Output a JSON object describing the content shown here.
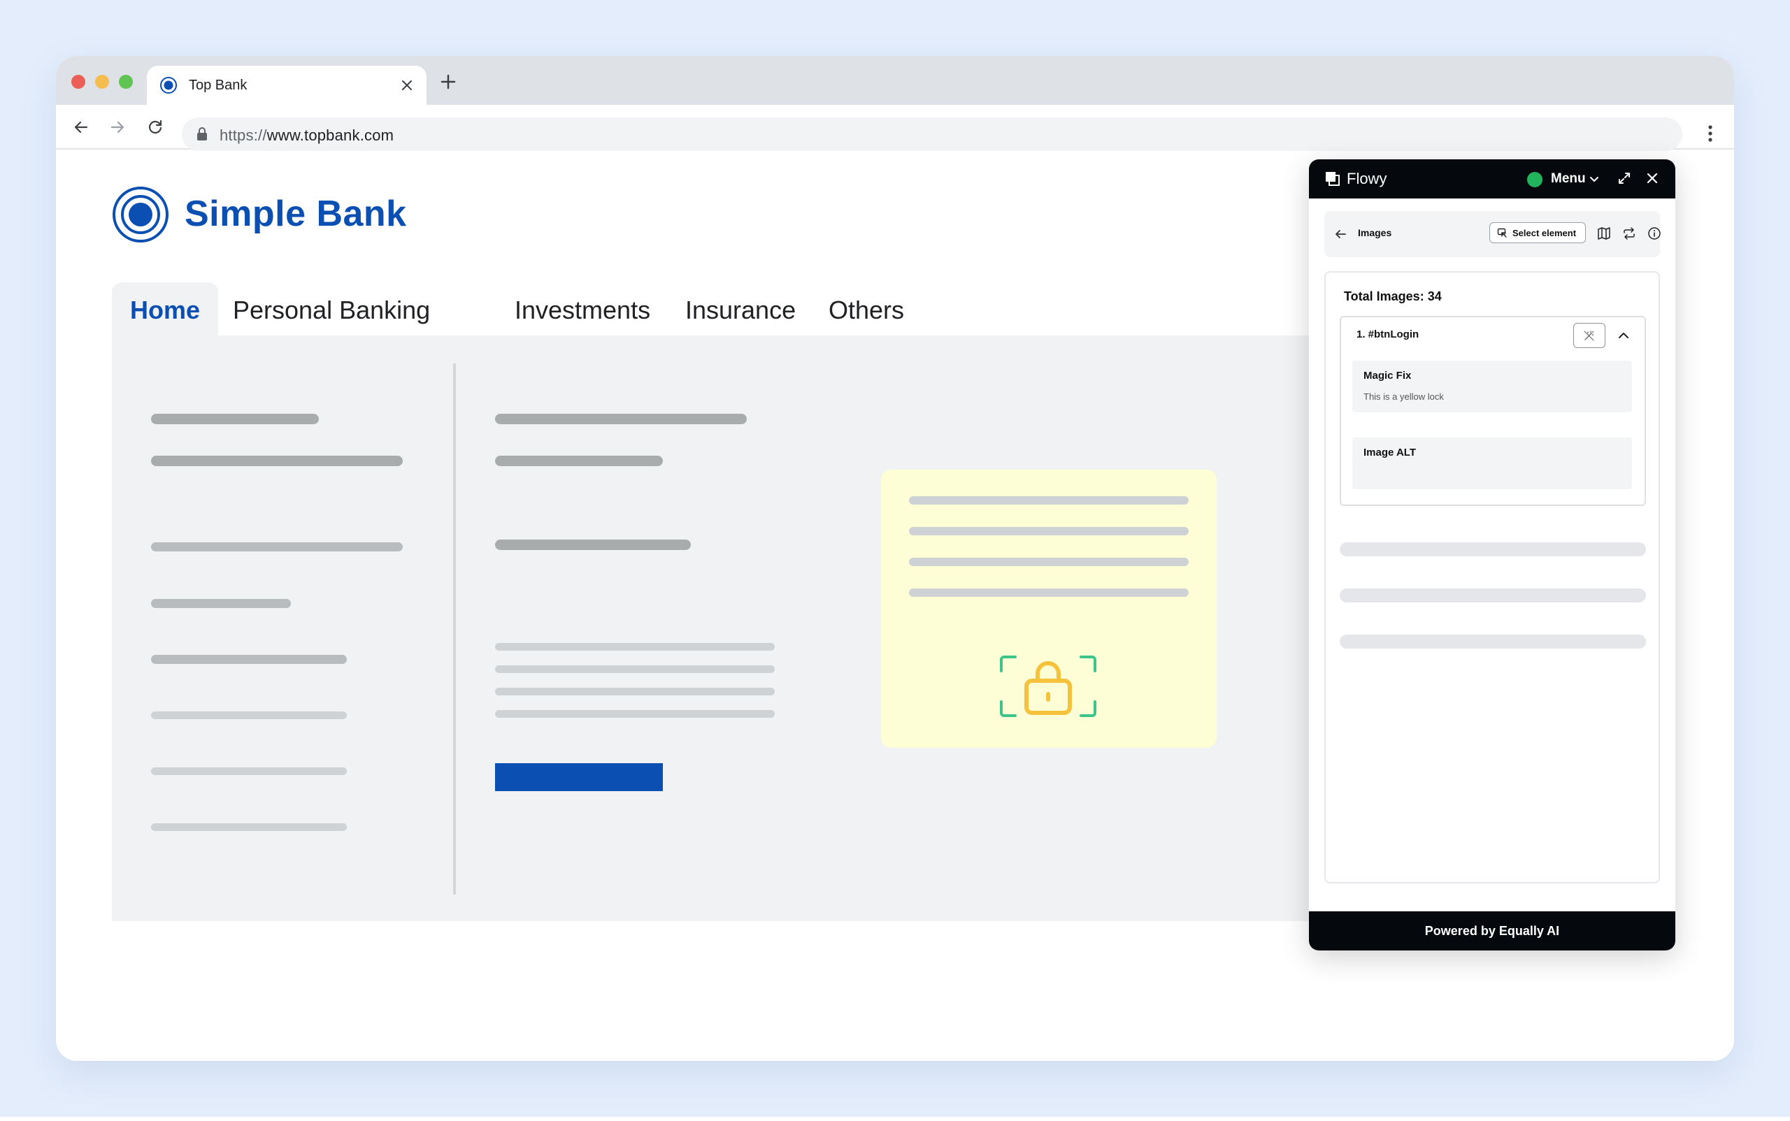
{
  "browser": {
    "tab_title": "Top Bank",
    "url_protocol": "https://",
    "url_host": "www.topbank.com"
  },
  "page": {
    "brand": "Simple Bank",
    "nav": [
      "Home",
      "Personal Banking",
      "Investments",
      "Insurance",
      "Others"
    ],
    "active_nav": "Home",
    "accent_color": "#0b4fb3",
    "highlight_card_color": "#fefed6"
  },
  "flowy": {
    "title": "Flowy",
    "menu_label": "Menu",
    "status_color": "#22b35d",
    "section_title": "Images",
    "select_element_label": "Select element",
    "total_images": "Total Images: 34",
    "item_title": "1. #btnLogin",
    "magic_fix_label": "Magic Fix",
    "magic_fix_value": "This is a yellow lock",
    "image_alt_label": "Image ALT",
    "image_alt_value": "",
    "footer": "Powered by Equally AI"
  }
}
